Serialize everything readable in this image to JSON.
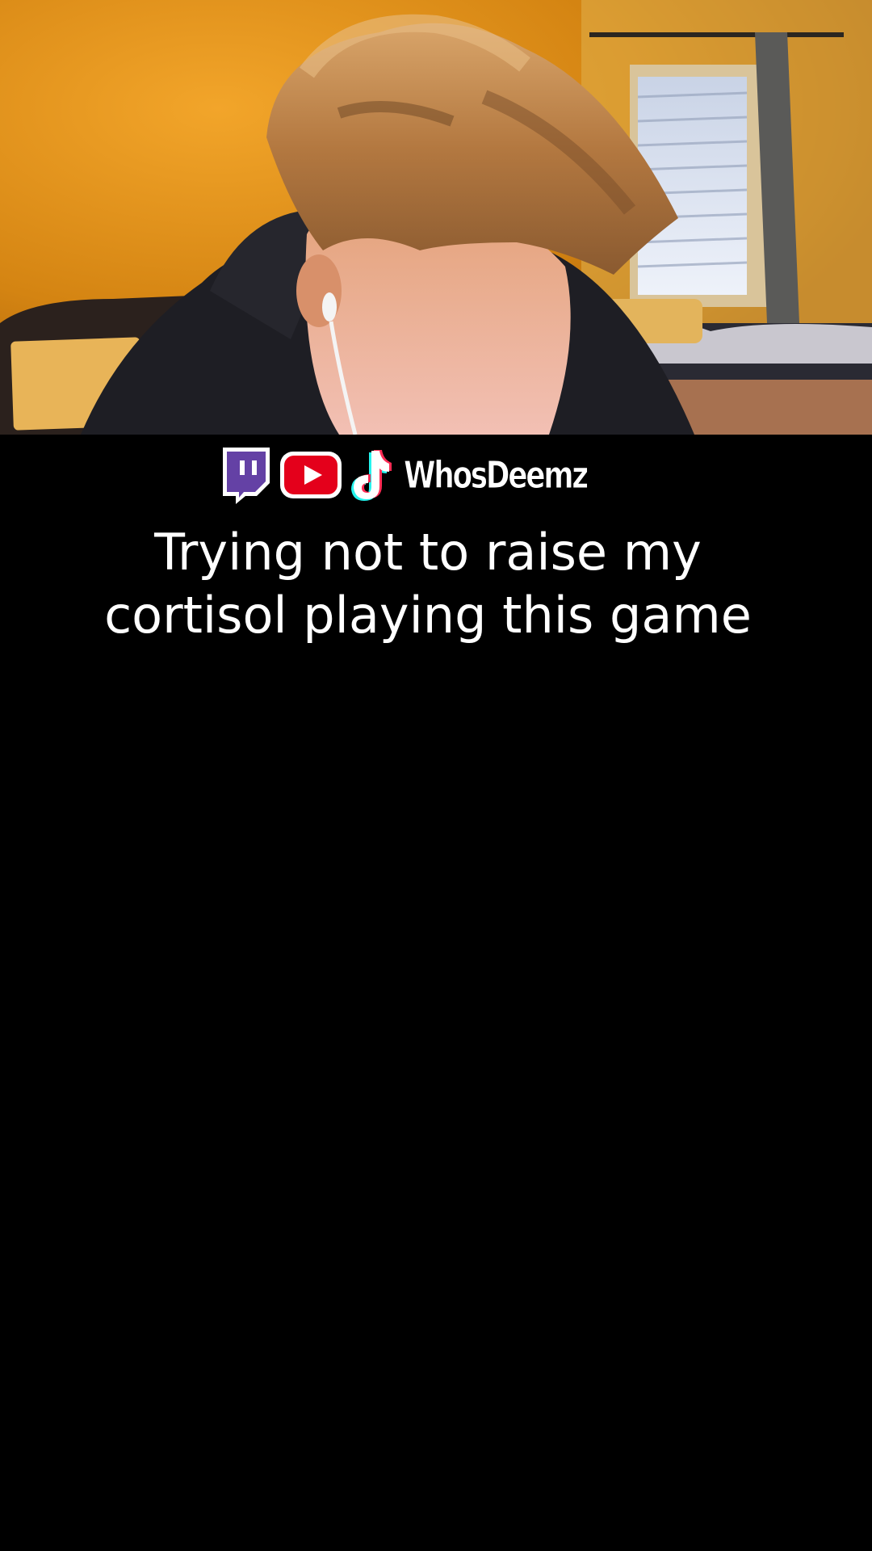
{
  "video": {
    "scene_label": "",
    "colors": {
      "wall": "#d88a14",
      "background": "#000000",
      "caption_text": "#ffffff"
    }
  },
  "social": {
    "icons": [
      "twitch-icon",
      "youtube-icon",
      "tiktok-icon"
    ],
    "handle": "WhosDeemz",
    "colors": {
      "twitch": "#6441a5",
      "youtube": "#e4001b",
      "tiktok_cyan": "#25f4ee"
    }
  },
  "caption": {
    "line1": "Trying not to raise my",
    "line2": "cortisol playing this game"
  }
}
